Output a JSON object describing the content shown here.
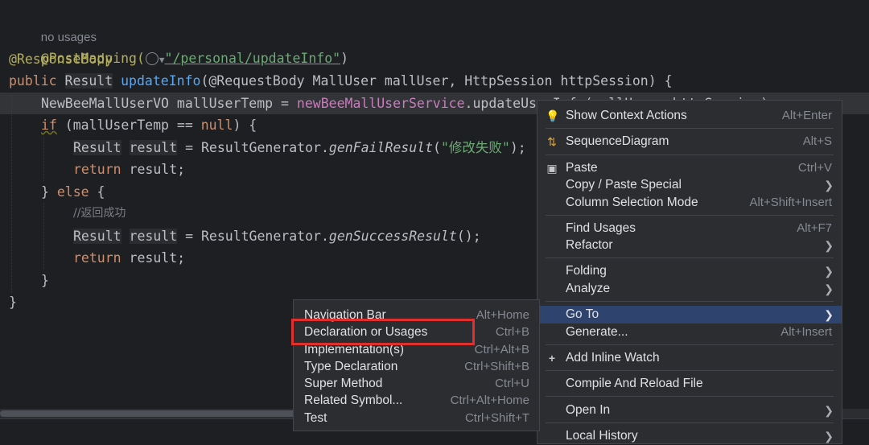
{
  "editor": {
    "usages_hint": "no usages",
    "line1_annotation": "@PostMapping(",
    "line1_url": "\"/personal/updateInfo\"",
    "line1_close": ")",
    "line2": "@ResponseBody",
    "line3_kw": "public",
    "line3_type": "Result",
    "line3_method": "updateInfo",
    "line3_params": "(@RequestBody MallUser mallUser, HttpSession httpSession) {",
    "line4_type": "NewBeeMallUserVO",
    "line4_var": " mallUserTemp = ",
    "line4_field": "newBeeMallUserService",
    "line4_call": ".updateUserInfo(mallUser, httpSession);",
    "line5_kw": "if",
    "line5_rest": " (mallUserTemp == ",
    "line5_null": "null",
    "line5_end": ") {",
    "line6_type": "Result",
    "line6_var": "result",
    "line6_eq": " = ResultGenerator.",
    "line6_method": "genFailResult",
    "line6_str": "\"修改失败\"",
    "line6_end": ");",
    "line7_kw": "return",
    "line7_rest": " result;",
    "line8_close": "} ",
    "line8_kw": "else",
    "line8_open": " {",
    "line9_comment": "//返回成功",
    "line10_type": "Result",
    "line10_var": "result",
    "line10_eq": " = ResultGenerator.",
    "line10_method": "genSuccessResult",
    "line10_end": "();",
    "line11_kw": "return",
    "line11_rest": " result;",
    "line12": "}",
    "line13": "}"
  },
  "context_menu": {
    "items": [
      {
        "label": "Show Context Actions",
        "shortcut": "Alt+Enter",
        "icon": "bulb-icon"
      },
      {
        "label": "SequenceDiagram",
        "shortcut": "Alt+S",
        "icon": "sequence-diagram-icon"
      },
      {
        "label": "Paste",
        "shortcut": "Ctrl+V",
        "icon": "clipboard-icon"
      },
      {
        "label": "Copy / Paste Special",
        "shortcut": "",
        "submenu": true
      },
      {
        "label": "Column Selection Mode",
        "shortcut": "Alt+Shift+Insert"
      },
      {
        "label": "Find Usages",
        "shortcut": "Alt+F7"
      },
      {
        "label": "Refactor",
        "shortcut": "",
        "submenu": true
      },
      {
        "label": "Folding",
        "shortcut": "",
        "submenu": true
      },
      {
        "label": "Analyze",
        "shortcut": "",
        "submenu": true
      },
      {
        "label": "Go To",
        "shortcut": "",
        "submenu": true,
        "active": true
      },
      {
        "label": "Generate...",
        "shortcut": "Alt+Insert"
      },
      {
        "label": "Add Inline Watch",
        "shortcut": "",
        "icon": "add-watch-icon"
      },
      {
        "label": "Compile And Reload File",
        "shortcut": ""
      },
      {
        "label": "Open In",
        "shortcut": "",
        "submenu": true
      },
      {
        "label": "Local History",
        "shortcut": "",
        "submenu": true
      }
    ]
  },
  "goto_submenu": {
    "items": [
      {
        "label": "Navigation Bar",
        "shortcut": "Alt+Home"
      },
      {
        "label": "Declaration or Usages",
        "shortcut": "Ctrl+B",
        "highlighted": true
      },
      {
        "label": "Implementation(s)",
        "shortcut": "Ctrl+Alt+B"
      },
      {
        "label": "Type Declaration",
        "shortcut": "Ctrl+Shift+B"
      },
      {
        "label": "Super Method",
        "shortcut": "Ctrl+U"
      },
      {
        "label": "Related Symbol...",
        "shortcut": "Ctrl+Alt+Home"
      },
      {
        "label": "Test",
        "shortcut": "Ctrl+Shift+T"
      }
    ]
  },
  "colors": {
    "background": "#1e1f22",
    "menu_bg": "#2b2d30",
    "active_item": "#2e436e",
    "highlight_box": "#e0302e"
  }
}
